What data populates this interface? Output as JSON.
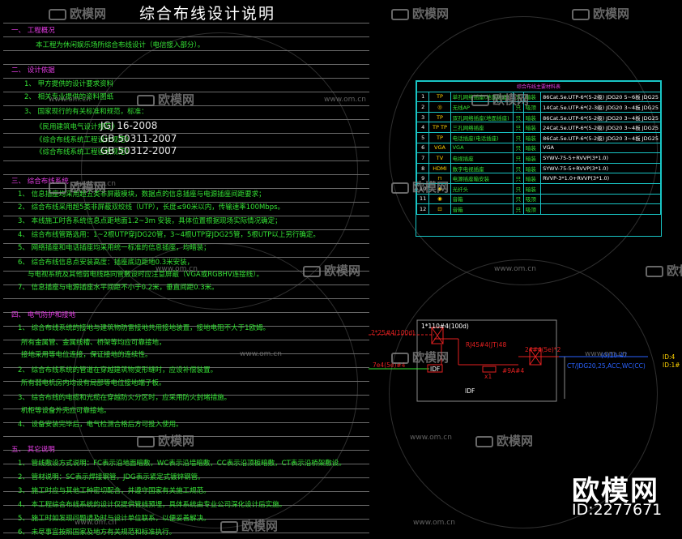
{
  "title": "综合布线设计说明",
  "watermark": {
    "brand": "欧模网",
    "url": "www.om.cn",
    "big_brand": "欧模网",
    "id_text": "ID:2277671"
  },
  "sections": [
    {
      "key": "s1",
      "heading": "一、 工程概况"
    },
    {
      "key": "s2",
      "heading": "二、 设计依据"
    },
    {
      "key": "s3",
      "heading": "三、 综合布线系统"
    },
    {
      "key": "s4",
      "heading": "四、 电气防护和接地"
    },
    {
      "key": "s5",
      "heading": "五、 其它说明"
    }
  ],
  "lines": {
    "s1_1": "本工程为休闲娱乐场所综合布线设计（电信接入部分）。",
    "s2_1": "1、 甲方提供的设计要求资料",
    "s2_2": "2、 相关专业提供的资料图纸",
    "s2_3": "3、 国家现行的有关标准和规范，标准：",
    "s2_4a": "《民用建筑电气设计规范》",
    "s2_4b": "JGJ 16-2008",
    "s2_5a": "《综合布线系统工程设计规范》",
    "s2_5b": "GB 50311-2007",
    "s2_6a": "《综合布线系统工程验收规范》",
    "s2_6b": "GB 50312-2007",
    "s3_1": "1、 信息插座均采用超五类非屏蔽模块，数据点的信息插座与电源插座间距要求；",
    "s3_2": "2、 综合布线采用超5类非屏蔽双绞线（UTP），长度≤90米以内，传输速率100Mbps。",
    "s3_3": "3、 本线施工时各系统信息点距地面1.2~3m 安装，具体位置根据现场实际情况确定；",
    "s3_4": "4、 综合布线管路选用：1~2根UTP穿JDG20管，3~4根UTP穿JDG25管，5根UTP以上另行确定。",
    "s3_5": "5、 网络插座和电话插座均采用统一标准的信息插座，均暗装；",
    "s3_6a": "6、 综合布线信息点安装高度：插座底边距地0.3米安装，",
    "s3_6b": "与电视系统及其他弱电线路同管敷设时应注意屏蔽（VGA或RGBHV连接线）。",
    "s3_7": "7、 信息插座与电源插座水平间距不小于0.2米，垂直间距0.3米。",
    "s4_1": "1、 综合布线系统的接地与建筑物防雷接地共用接地装置，接地电阻不大于1欧姆。",
    "s4_2a": "  所有金属管、金属线槽、桥架等均应可靠接地，",
    "s4_2b": "  接地采用等电位连接，保证接地的连续性。",
    "s4_3": "2、 综合布线系统的管道在穿越建筑物变形缝时，应设补偿装置。",
    "s4_4": "  所有弱电机房内均设有局部等电位接地端子板。",
    "s4_5": "3、 综合布线的电缆和光缆在穿越防火分区时，应采用防火封堵措施。",
    "s4_6": "  机柜等设备外壳应可靠接地。",
    "s4_7": "4、 设备安装完毕后，电气检测合格后方可投入使用。",
    "s5_1": "1、 管线敷设方式说明：FC表示沿地面暗敷，WC表示沿墙暗敷，CC表示沿顶板暗敷，CT表示沿桥架敷设。",
    "s5_2": "2、 管材说明：SC表示焊接钢管，JDG表示紧定式镀锌钢管。",
    "s5_3": "3、 施工时应与其他工种密切配合，并遵守国家有关施工规范。",
    "s5_4": "4、 本工程综合布线系统的设计仅提供管线预埋，具体系统由专业公司深化设计后实施。",
    "s5_5": "5、 施工时如发现问题请及时与设计单位联系，以便妥善解决。",
    "s5_6": "6、 未尽事宜按照国家及地方有关规范和标准执行。"
  },
  "legend": {
    "title": "综合布线主要材料表",
    "rows": [
      {
        "num": "1",
        "sym": "TP",
        "name": "单孔网络插座(地面插座)",
        "unit": "只",
        "inst": "暗装",
        "rem": "86Cat.5e.UTP-6*(5-2级) JDG20 5~6板 JDG25"
      },
      {
        "num": "2",
        "sym": "◎",
        "name": "无线AP",
        "unit": "只",
        "inst": "吸顶",
        "rem": "14Cat.5e.UTP-6*(2-3级) JDG20 3~4板 JDG25"
      },
      {
        "num": "3",
        "sym": "TP",
        "name": "双孔网络插座(地面插座)",
        "unit": "只",
        "inst": "暗装",
        "rem": "86Cat.5e.UTP-6*(5-2级) JDG20 3~4板 JDG25"
      },
      {
        "num": "4",
        "sym": "TP TP",
        "name": "三孔网络插座",
        "unit": "只",
        "inst": "暗装",
        "rem": "24Cat.5e.UTP-6*(5-2级) JDG20 3~4板 JDG25"
      },
      {
        "num": "5",
        "sym": "TP",
        "name": "电话插座(电话插座)",
        "unit": "只",
        "inst": "暗装",
        "rem": "86Cat.5e.UTP-6*(5-2级) JDG20 3~4板 JDG25"
      },
      {
        "num": "6",
        "sym": "VGA",
        "name": "VGA",
        "unit": "只",
        "inst": "暗装",
        "rem": "VGA"
      },
      {
        "num": "7",
        "sym": "TV",
        "name": "电视插座",
        "unit": "只",
        "inst": "暗装",
        "rem": "SYWV-75-5+RVVP(3*1.0)"
      },
      {
        "num": "8",
        "sym": "HDMI",
        "name": "数字电视插座",
        "unit": "只",
        "inst": "暗装",
        "rem": "SYWV-75-5+RVVP(3*1.0)"
      },
      {
        "num": "9",
        "sym": "⊓",
        "name": "电源插座箱安装",
        "unit": "只",
        "inst": "暗装",
        "rem": "RVVP-3*1.0+RVVP(3*1.0)"
      },
      {
        "num": "10",
        "sym": "◆",
        "name": "光纤头",
        "unit": "只",
        "inst": "暗装",
        "rem": ""
      },
      {
        "num": "11",
        "sym": "◉",
        "name": "音箱",
        "unit": "只",
        "inst": "吸顶",
        "rem": ""
      },
      {
        "num": "12",
        "sym": "⊡",
        "name": "音箱",
        "unit": "只",
        "inst": "吸顶",
        "rem": ""
      }
    ]
  },
  "diagram": {
    "top_label": "1*110#4(100d)",
    "left_label": "2*25#4(100d)",
    "mid_label": "RJ45#4(JT)48",
    "right_label": "24#4(5e)*2",
    "box_small": "IDF",
    "cable_left": "7e4(5e)#4",
    "cable_sub": "x1",
    "port_label": "#9A#4",
    "idf_label": "IDF",
    "right_cable": "(0)10-47",
    "right_cable2": "CT/JDG20,25,ACC,WC(CC)",
    "far_right": "ID:4",
    "far_right2": "ID:1#"
  }
}
